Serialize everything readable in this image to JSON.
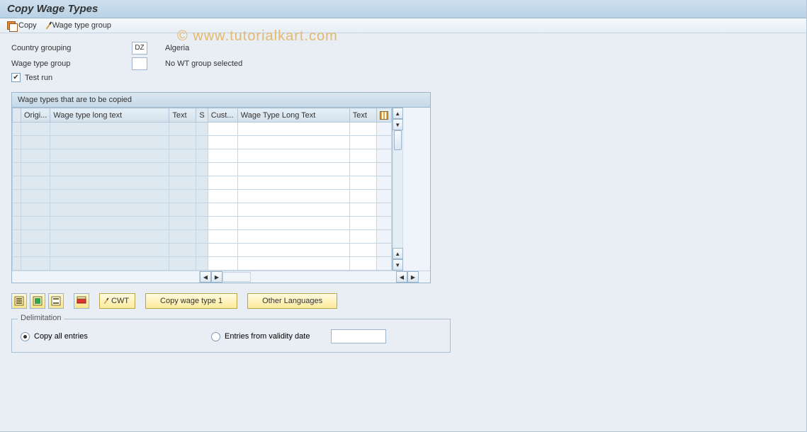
{
  "title": "Copy Wage Types",
  "toolbar": {
    "copy_label": "Copy",
    "wage_type_group_label": "Wage type group"
  },
  "watermark": "© www.tutorialkart.com",
  "fields": {
    "country_grouping_label": "Country grouping",
    "country_grouping_value": "DZ",
    "country_grouping_text": "Algeria",
    "wage_type_group_label": "Wage type group",
    "wage_type_group_value": "",
    "wage_type_group_text": "No WT group selected",
    "test_run_label": "Test run",
    "test_run_checked": true
  },
  "grid": {
    "title": "Wage types that are to be copied",
    "columns": {
      "origi": "Origi...",
      "wtlt": "Wage type long text",
      "text": "Text",
      "s": "S",
      "cust": "Cust...",
      "wtlt2": "Wage Type Long Text",
      "text2": "Text"
    },
    "row_count": 11
  },
  "actions": {
    "cwt_label": "CWT",
    "copy_wage_type_label": "Copy wage type 1",
    "other_languages_label": "Other Languages"
  },
  "delimitation": {
    "legend": "Delimitation",
    "copy_all_label": "Copy all entries",
    "entries_from_label": "Entries from validity date",
    "selected": "copy_all"
  }
}
